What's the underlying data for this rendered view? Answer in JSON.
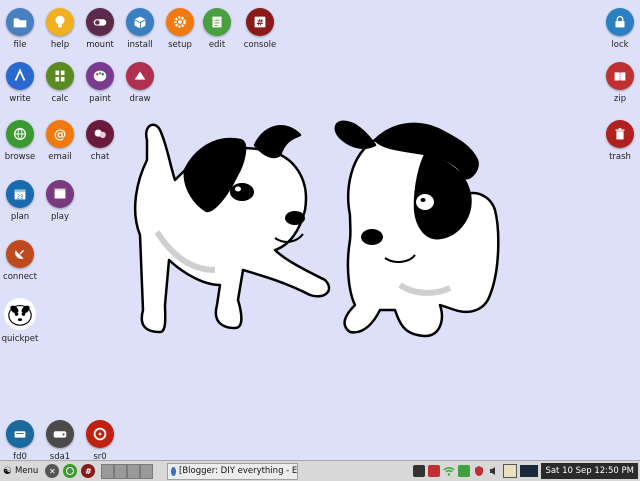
{
  "desktop": {
    "icons_left": [
      {
        "label": "file",
        "icon": "folder-icon",
        "color": "#4a7fc0"
      },
      {
        "label": "help",
        "icon": "lightbulb-icon",
        "color": "#f0b020"
      },
      {
        "label": "mount",
        "icon": "toggle-icon",
        "color": "#5a2a4a"
      },
      {
        "label": "install",
        "icon": "package-box-icon",
        "color": "#3a80c0"
      },
      {
        "label": "setup",
        "icon": "gear-icon",
        "color": "#f07a10"
      },
      {
        "label": "edit",
        "icon": "notepad-icon",
        "color": "#4aa040"
      },
      {
        "label": "console",
        "icon": "terminal-hash-icon",
        "color": "#8a1a1a"
      },
      {
        "label": "write",
        "icon": "write-pen-icon",
        "color": "#2a6ad0"
      },
      {
        "label": "calc",
        "icon": "calculator-icon",
        "color": "#5a8a20"
      },
      {
        "label": "paint",
        "icon": "palette-icon",
        "color": "#7a3a90"
      },
      {
        "label": "draw",
        "icon": "vector-draw-icon",
        "color": "#b03050"
      },
      {
        "label": "browse",
        "icon": "globe-icon",
        "color": "#3a9a30"
      },
      {
        "label": "email",
        "icon": "at-sign-icon",
        "color": "#f07a10"
      },
      {
        "label": "chat",
        "icon": "chat-bubbles-icon",
        "color": "#6a1a3a"
      },
      {
        "label": "plan",
        "icon": "calendar-icon",
        "color": "#1a6ab0"
      },
      {
        "label": "play",
        "icon": "film-icon",
        "color": "#7a3a80"
      },
      {
        "label": "connect",
        "icon": "satellite-dish-icon",
        "color": "#c04a20"
      },
      {
        "label": "quickpet",
        "icon": "puppy-face-icon",
        "color": "#ffffff"
      },
      {
        "label": "fd0",
        "icon": "drive-icon",
        "color": "#1a6aa0"
      },
      {
        "label": "sda1",
        "icon": "hard-disk-icon",
        "color": "#4a4a4a"
      },
      {
        "label": "sr0",
        "icon": "optical-disc-icon",
        "color": "#c02010"
      }
    ],
    "icons_right": [
      {
        "label": "lock",
        "icon": "lock-icon",
        "color": "#2a80c0"
      },
      {
        "label": "zip",
        "icon": "zip-archive-icon",
        "color": "#c03030"
      },
      {
        "label": "trash",
        "icon": "trash-icon",
        "color": "#b02020"
      }
    ]
  },
  "taskbar": {
    "menu_label": "Menu",
    "task_title": "[Blogger: DIY everything - E",
    "clock": "Sat 10 Sep 12:50 PM"
  }
}
